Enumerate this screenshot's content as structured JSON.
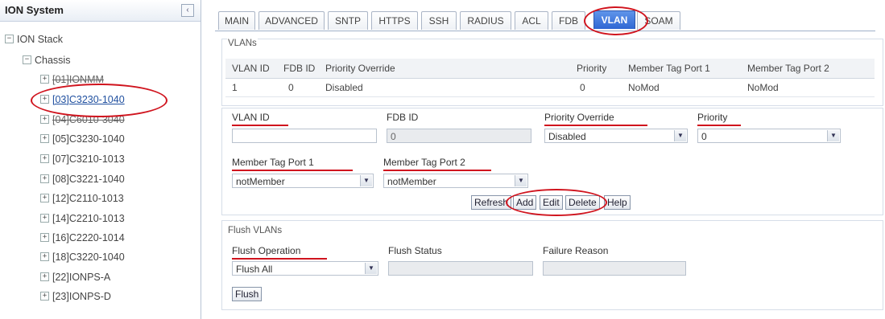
{
  "left_panel": {
    "title": "ION System",
    "collapse_glyph": "‹",
    "tree": [
      {
        "toggle": "−",
        "label": "ION Stack"
      },
      {
        "toggle": "−",
        "label": "Chassis"
      },
      {
        "toggle": "+",
        "label": "[01]IONMM"
      },
      {
        "toggle": "+",
        "label": "[03]C3230-1040"
      },
      {
        "toggle": "+",
        "label": "[04]C6010-3040"
      },
      {
        "toggle": "+",
        "label": "[05]C3230-1040"
      },
      {
        "toggle": "+",
        "label": "[07]C3210-1013"
      },
      {
        "toggle": "+",
        "label": "[08]C3221-1040"
      },
      {
        "toggle": "+",
        "label": "[12]C2110-1013"
      },
      {
        "toggle": "+",
        "label": "[14]C2210-1013"
      },
      {
        "toggle": "+",
        "label": "[16]C2220-1014"
      },
      {
        "toggle": "+",
        "label": "[18]C3220-1040"
      },
      {
        "toggle": "+",
        "label": "[22]IONPS-A"
      },
      {
        "toggle": "+",
        "label": "[23]IONPS-D"
      }
    ]
  },
  "tabs": [
    "MAIN",
    "ADVANCED",
    "SNTP",
    "HTTPS",
    "SSH",
    "RADIUS",
    "ACL",
    "FDB",
    "VLAN",
    "SOAM"
  ],
  "active_tab": "VLAN",
  "vlans": {
    "legend": "VLANs",
    "columns": [
      "VLAN ID",
      "FDB ID",
      "Priority Override",
      "Priority",
      "Member Tag Port 1",
      "Member Tag Port 2"
    ],
    "rows": [
      [
        "1",
        "0",
        "Disabled",
        "0",
        "NoMod",
        "NoMod"
      ]
    ]
  },
  "form": {
    "vlan_id": {
      "label": "VLAN ID",
      "value": ""
    },
    "fdb_id": {
      "label": "FDB ID",
      "value": "0"
    },
    "priority_override": {
      "label": "Priority Override",
      "value": "Disabled"
    },
    "priority": {
      "label": "Priority",
      "value": "0"
    },
    "member_tag_port1": {
      "label": "Member Tag Port 1",
      "value": "notMember"
    },
    "member_tag_port2": {
      "label": "Member Tag Port 2",
      "value": "notMember"
    }
  },
  "buttons": {
    "refresh": "Refresh",
    "add": "Add",
    "edit": "Edit",
    "delete": "Delete",
    "help": "Help",
    "flush": "Flush"
  },
  "flush": {
    "legend": "Flush VLANs",
    "operation": {
      "label": "Flush Operation",
      "value": "Flush All"
    },
    "status": {
      "label": "Flush Status",
      "value": ""
    },
    "failure": {
      "label": "Failure Reason",
      "value": ""
    }
  },
  "colors": {
    "annotation_red": "#d0141e",
    "active_tab_blue": "#2f66d3"
  },
  "icons": {
    "dropdown": "chevron-down-icon",
    "collapse": "chevron-left-icon"
  }
}
